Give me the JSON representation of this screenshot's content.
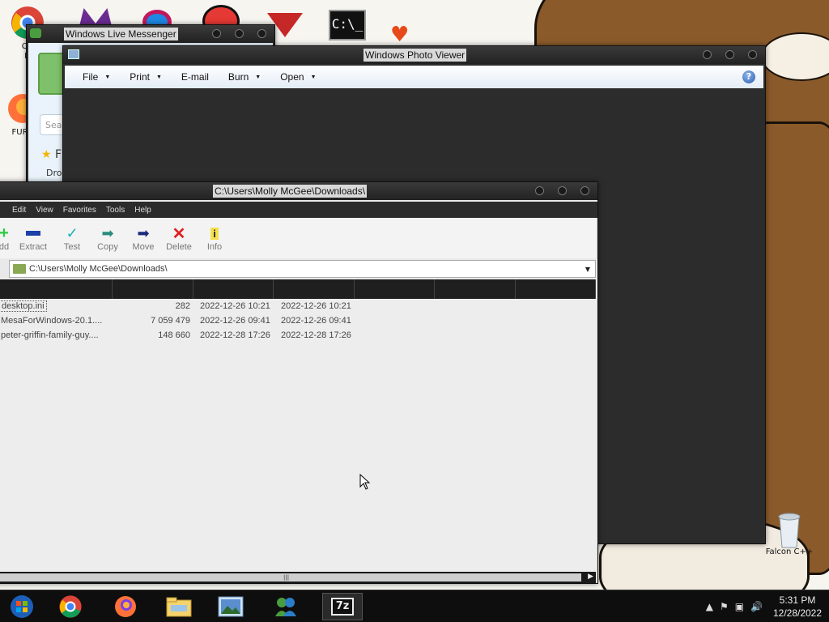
{
  "desktop": {
    "icons": [
      {
        "label": "CH\nD",
        "name": "chrome-desktop-icon"
      },
      {
        "label": "FURR",
        "name": "furr-desktop-icon"
      },
      {
        "label": "Falcon C++",
        "name": "falcon-cpp-icon"
      }
    ]
  },
  "messenger": {
    "title": "Windows Live Messenger",
    "search_stub": "Sea",
    "fav_stub": "F",
    "drop_stub": "Dro"
  },
  "photo_viewer": {
    "title": "Windows Photo Viewer",
    "menu": [
      {
        "label": "File",
        "has_arrow": true
      },
      {
        "label": "Print",
        "has_arrow": true
      },
      {
        "label": "E-mail",
        "has_arrow": false
      },
      {
        "label": "Burn",
        "has_arrow": true
      },
      {
        "label": "Open",
        "has_arrow": true
      }
    ],
    "help": "?"
  },
  "sevenzip": {
    "title": "C:\\Users\\Molly McGee\\Downloads\\",
    "menu": [
      "Edit",
      "View",
      "Favorites",
      "Tools",
      "Help"
    ],
    "toolbar": [
      {
        "label": "dd",
        "icon": "add-icon"
      },
      {
        "label": "Extract",
        "icon": "extract-icon"
      },
      {
        "label": "Test",
        "icon": "test-icon"
      },
      {
        "label": "Copy",
        "icon": "copy-icon"
      },
      {
        "label": "Move",
        "icon": "move-icon"
      },
      {
        "label": "Delete",
        "icon": "delete-icon"
      },
      {
        "label": "Info",
        "icon": "info-icon"
      }
    ],
    "address": "C:\\Users\\Molly McGee\\Downloads\\",
    "files": [
      {
        "name": "desktop.ini",
        "size": "282",
        "modified": "2022-12-26 10:21",
        "created": "2022-12-26 10:21"
      },
      {
        "name": "MesaForWindows-20.1....",
        "size": "7 059 479",
        "modified": "2022-12-26 09:41",
        "created": "2022-12-26 09:41"
      },
      {
        "name": "peter-griffin-family-guy....",
        "size": "148 660",
        "modified": "2022-12-28 17:26",
        "created": "2022-12-28 17:26"
      }
    ]
  },
  "taskbar": {
    "apps": [
      "windows-logo-icon",
      "chrome-icon",
      "firefox-icon",
      "file-explorer-icon",
      "photo-viewer-icon",
      "messenger-icon",
      "sevenzip-icon"
    ],
    "sevenzip_label": "7z",
    "time": "5:31 PM",
    "date": "12/28/2022"
  }
}
